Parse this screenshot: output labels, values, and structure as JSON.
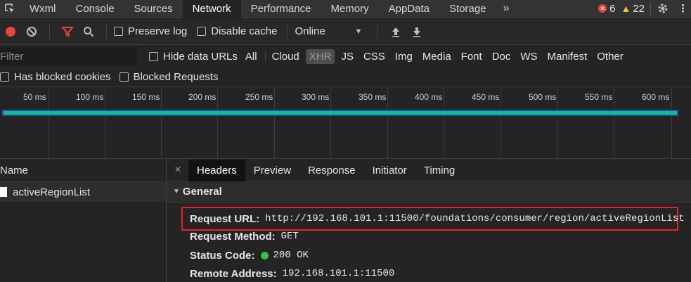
{
  "tabs": [
    "Wxml",
    "Console",
    "Sources",
    "Network",
    "Performance",
    "Memory",
    "AppData",
    "Storage"
  ],
  "active_tab": "Network",
  "overflow_label": "»",
  "errors_count": "6",
  "warnings_count": "22",
  "toolbar": {
    "preserve_log_label": "Preserve log",
    "disable_cache_label": "Disable cache",
    "throttle_value": "Online",
    "throttle_arrow": "▼"
  },
  "filter": {
    "placeholder": "Filter",
    "hide_data_urls_label": "Hide data URLs",
    "types": [
      "All",
      "Cloud",
      "XHR",
      "JS",
      "CSS",
      "Img",
      "Media",
      "Font",
      "Doc",
      "WS",
      "Manifest",
      "Other"
    ],
    "selected_type": "XHR"
  },
  "blocked": {
    "has_blocked_cookies_label": "Has blocked cookies",
    "blocked_requests_label": "Blocked Requests"
  },
  "timeline": {
    "ticks": [
      "50 ms",
      "100 ms",
      "150 ms",
      "200 ms",
      "250 ms",
      "300 ms",
      "350 ms",
      "400 ms",
      "450 ms",
      "500 ms",
      "550 ms",
      "600 ms"
    ]
  },
  "requests": {
    "column_name": "Name",
    "items": [
      "activeRegionList"
    ]
  },
  "details": {
    "tabs": [
      "Headers",
      "Preview",
      "Response",
      "Initiator",
      "Timing"
    ],
    "active_tab": "Headers",
    "section": "General",
    "request_url_label": "Request URL:",
    "request_url_value": "http://192.168.101.1:11500/foundations/consumer/region/activeRegionList",
    "request_method_label": "Request Method:",
    "request_method_value": "GET",
    "status_code_label": "Status Code:",
    "status_code_value": "200 OK",
    "remote_address_label": "Remote Address:",
    "remote_address_value": "192.168.101.1:11500"
  },
  "colors": {
    "record_red": "#e8453c",
    "filter_active": "#e8453c",
    "status_ok": "#34c437",
    "highlight_box": "#e8212b",
    "waterfall_bar": "#13c07b"
  }
}
